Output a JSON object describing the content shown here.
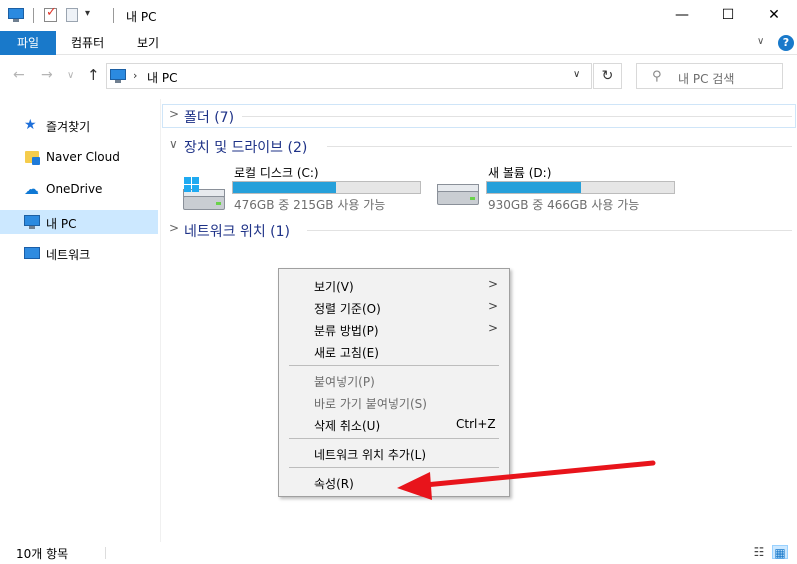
{
  "window": {
    "title": "내 PC",
    "minimize_glyph": "—",
    "maximize_glyph": "☐",
    "close_glyph": "✕"
  },
  "quick_access": {
    "customize_glyph": "▾"
  },
  "ribbon": {
    "tabs": [
      "파일",
      "컴퓨터",
      "보기"
    ],
    "active_tab": "파일",
    "expand_glyph": "∨",
    "help_glyph": "?"
  },
  "navigation": {
    "back_glyph": "←",
    "forward_glyph": "→",
    "recent_glyph": "∨",
    "up_glyph": "↑"
  },
  "address_bar": {
    "separator": "›",
    "path": "내 PC",
    "dropdown_glyph": "∨",
    "refresh_glyph": "↻"
  },
  "search": {
    "icon_glyph": "⚲",
    "placeholder": "내 PC 검색"
  },
  "sidebar": {
    "items": [
      {
        "label": "즐겨찾기",
        "icon": "star-icon"
      },
      {
        "label": "Naver Cloud",
        "icon": "folder-icon"
      },
      {
        "label": "OneDrive",
        "icon": "cloud-icon"
      },
      {
        "label": "내 PC",
        "icon": "pc-icon",
        "selected": true
      },
      {
        "label": "네트워크",
        "icon": "network-icon"
      }
    ]
  },
  "groups": {
    "folders": {
      "chevron": ">",
      "title": "폴더 (7)"
    },
    "drives": {
      "chevron": "∨",
      "title": "장치 및 드라이브 (2)"
    },
    "network": {
      "chevron": ">",
      "title": "네트워크 위치 (1)"
    }
  },
  "drives": [
    {
      "name": "로컬 디스크 (C:)",
      "free_text": "476GB 중 215GB 사용 가능",
      "used_fraction": 0.55,
      "icon": "windows-drive-icon"
    },
    {
      "name": "새 볼륨 (D:)",
      "free_text": "930GB 중 466GB 사용 가능",
      "used_fraction": 0.5,
      "icon": "drive-icon"
    }
  ],
  "context_menu": {
    "items": [
      {
        "label": "보기(V)",
        "submenu": true,
        "enabled": true
      },
      {
        "label": "정렬 기준(O)",
        "submenu": true,
        "enabled": true
      },
      {
        "label": "분류 방법(P)",
        "submenu": true,
        "enabled": true
      },
      {
        "label": "새로 고침(E)",
        "submenu": false,
        "enabled": true
      },
      {
        "label": "붙여넣기(P)",
        "submenu": false,
        "enabled": false
      },
      {
        "label": "바로 가기 붙여넣기(S)",
        "submenu": false,
        "enabled": false
      },
      {
        "label": "삭제 취소(U)",
        "submenu": false,
        "enabled": true,
        "shortcut": "Ctrl+Z"
      },
      {
        "label": "네트워크 위치 추가(L)",
        "submenu": false,
        "enabled": true
      },
      {
        "label": "속성(R)",
        "submenu": false,
        "enabled": true
      }
    ],
    "submenu_glyph": ">"
  },
  "annotation": {
    "arrow_color": "#e8141b"
  },
  "status_bar": {
    "item_count": "10개 항목",
    "details_view_glyph": "☷",
    "tiles_view_glyph": "▦"
  },
  "colors": {
    "accent": "#1979ca",
    "selection": "#cce8ff",
    "drive_fill": "#26a0da"
  }
}
